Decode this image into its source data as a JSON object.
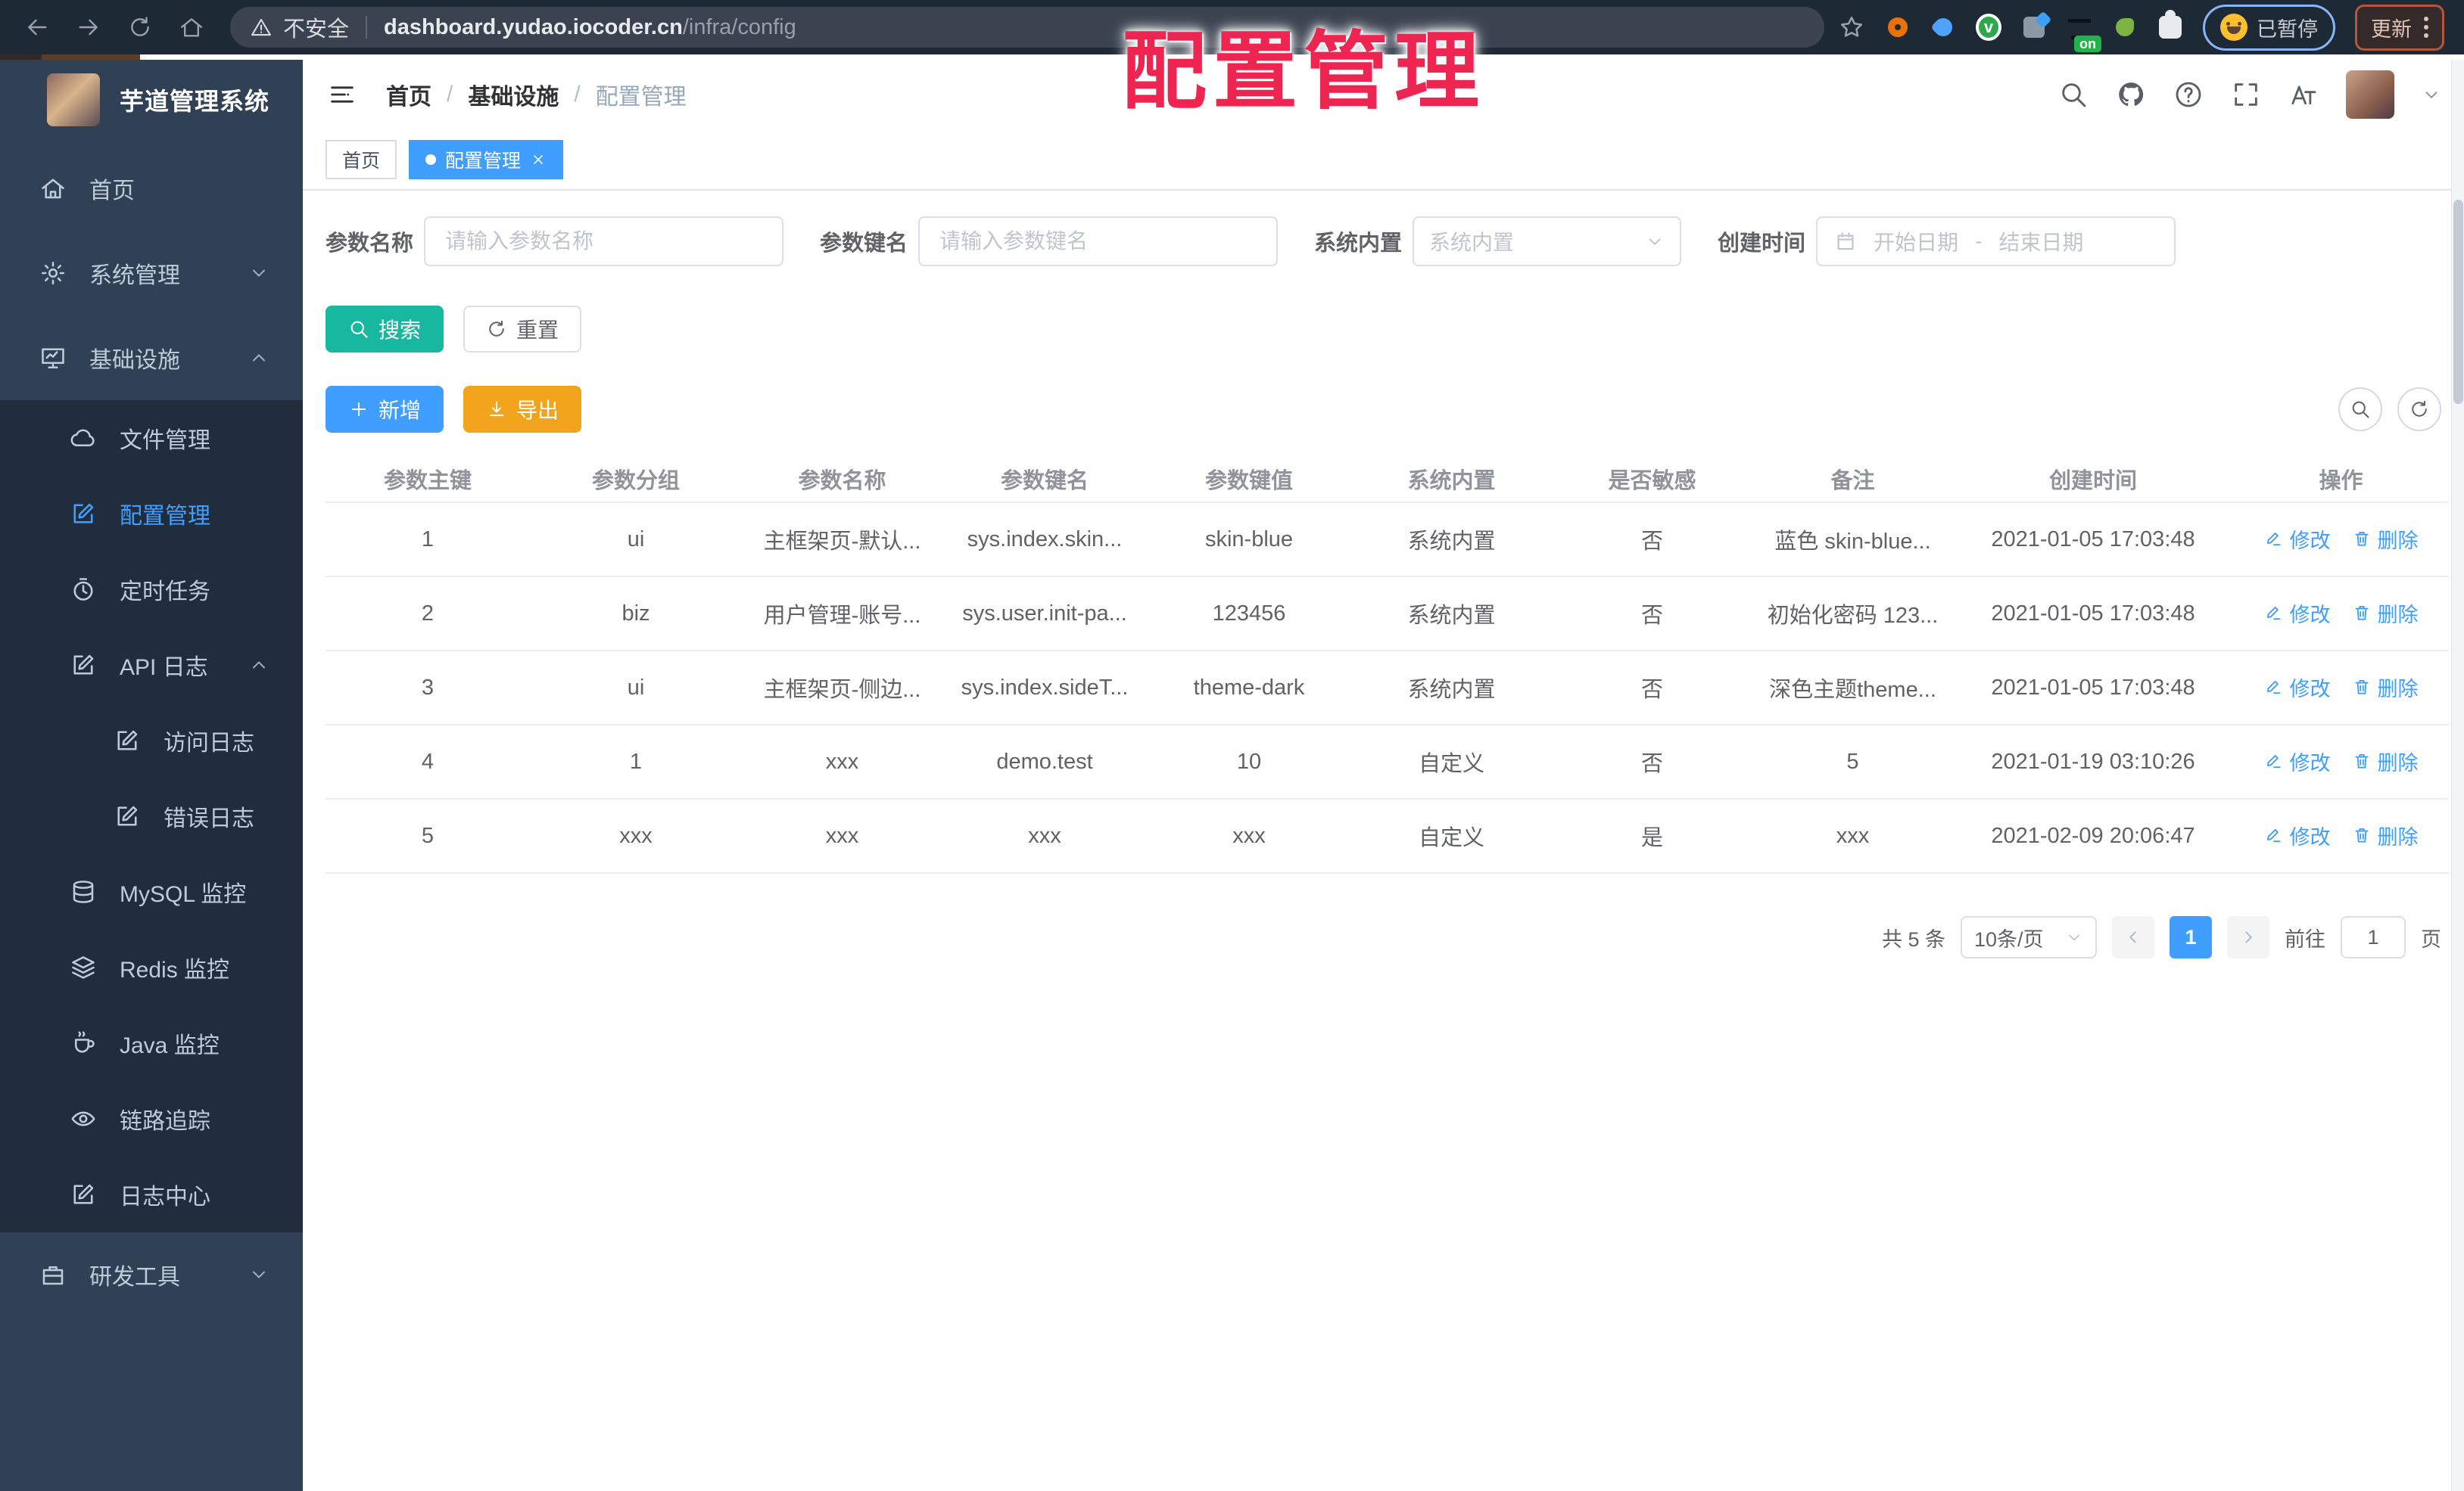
{
  "annotation": {
    "title": "配置管理"
  },
  "browser": {
    "security_label": "不安全",
    "url_host": "dashboard.yudao.iocoder.cn",
    "url_path": "/infra/config",
    "on_badge": "on",
    "paused_label": "已暂停",
    "update_label": "更新"
  },
  "sidebar": {
    "title": "芋道管理系统",
    "menu": [
      {
        "id": "home",
        "label": "首页",
        "icon": "home",
        "level": 1
      },
      {
        "id": "system",
        "label": "系统管理",
        "icon": "gear",
        "level": 1,
        "arrow": "down"
      },
      {
        "id": "infra",
        "label": "基础设施",
        "icon": "monitor",
        "level": 1,
        "arrow": "up"
      },
      {
        "id": "file",
        "label": "文件管理",
        "icon": "cloud",
        "level": 2
      },
      {
        "id": "config",
        "label": "配置管理",
        "icon": "editsq",
        "level": 2,
        "active": true
      },
      {
        "id": "job",
        "label": "定时任务",
        "icon": "timer",
        "level": 2
      },
      {
        "id": "api-log",
        "label": "API 日志",
        "icon": "editsq",
        "level": 2,
        "arrow": "up"
      },
      {
        "id": "access-log",
        "label": "访问日志",
        "icon": "editsq",
        "level": 3
      },
      {
        "id": "error-log",
        "label": "错误日志",
        "icon": "editsq",
        "level": 3
      },
      {
        "id": "mysql",
        "label": "MySQL 监控",
        "icon": "mysql",
        "level": 2
      },
      {
        "id": "redis",
        "label": "Redis 监控",
        "icon": "redis",
        "level": 2
      },
      {
        "id": "java",
        "label": "Java 监控",
        "icon": "java",
        "level": 2
      },
      {
        "id": "trace",
        "label": "链路追踪",
        "icon": "eye",
        "level": 2
      },
      {
        "id": "log-center",
        "label": "日志中心",
        "icon": "editsq",
        "level": 2
      },
      {
        "id": "dev-tool",
        "label": "研发工具",
        "icon": "case",
        "level": 1,
        "arrow": "down"
      }
    ]
  },
  "header": {
    "breadcrumb": [
      "首页",
      "基础设施",
      "配置管理"
    ],
    "breadcrumb_separator": "/"
  },
  "tags": {
    "items": [
      {
        "id": "home",
        "label": "首页",
        "active": false
      },
      {
        "id": "config",
        "label": "配置管理",
        "active": true
      }
    ]
  },
  "filters": {
    "name_label": "参数名称",
    "name_placeholder": "请输入参数名称",
    "key_label": "参数键名",
    "key_placeholder": "请输入参数键名",
    "type_label": "系统内置",
    "type_placeholder": "系统内置",
    "date_label": "创建时间",
    "date_start": "开始日期",
    "date_separator": "-",
    "date_end": "结束日期"
  },
  "toolbar": {
    "search_label": "搜索",
    "reset_label": "重置",
    "add_label": "新增",
    "export_label": "导出"
  },
  "table": {
    "headers": [
      "参数主键",
      "参数分组",
      "参数名称",
      "参数键名",
      "参数键值",
      "系统内置",
      "是否敏感",
      "备注",
      "创建时间",
      "操作"
    ],
    "edit_label": "修改",
    "delete_label": "删除",
    "rows": [
      {
        "cells": [
          "1",
          "ui",
          "主框架页-默认...",
          "sys.index.skin...",
          "skin-blue",
          "系统内置",
          "否",
          "蓝色 skin-blue...",
          "2021-01-05 17:03:48"
        ]
      },
      {
        "cells": [
          "2",
          "biz",
          "用户管理-账号...",
          "sys.user.init-pa...",
          "123456",
          "系统内置",
          "否",
          "初始化密码 123...",
          "2021-01-05 17:03:48"
        ]
      },
      {
        "cells": [
          "3",
          "ui",
          "主框架页-侧边...",
          "sys.index.sideT...",
          "theme-dark",
          "系统内置",
          "否",
          "深色主题theme...",
          "2021-01-05 17:03:48"
        ]
      },
      {
        "cells": [
          "4",
          "1",
          "xxx",
          "demo.test",
          "10",
          "自定义",
          "否",
          "5",
          "2021-01-19 03:10:26"
        ]
      },
      {
        "cells": [
          "5",
          "xxx",
          "xxx",
          "xxx",
          "xxx",
          "自定义",
          "是",
          "xxx",
          "2021-02-09 20:06:47"
        ]
      }
    ]
  },
  "pagination": {
    "total": "共 5 条",
    "page_size": "10条/页",
    "current_page": "1",
    "goto_label": "前往",
    "goto_value": "1",
    "page_unit": "页"
  },
  "colors": {
    "accent": "#409eff",
    "teal": "#18b79f",
    "warning": "#f2a51c",
    "sidebar_bg": "#304156",
    "submenu_bg": "#1f2d3d",
    "annotation": "#ee2550"
  }
}
